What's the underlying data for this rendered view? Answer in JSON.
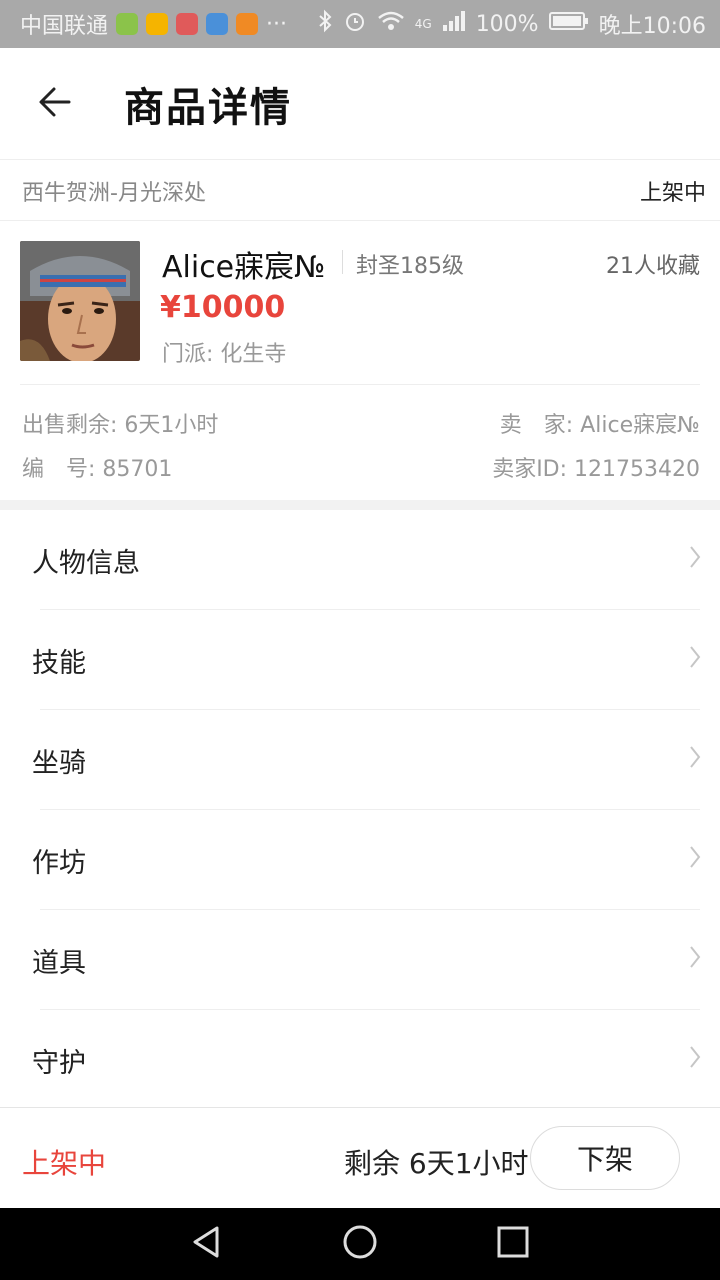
{
  "statusbar": {
    "carrier": "中国联通",
    "more": "···",
    "network": "4G",
    "battery": "100%",
    "time": "晚上10:06",
    "app_icons": [
      {
        "name": "green-app-icon",
        "color": "#8bc34a"
      },
      {
        "name": "weibo-icon",
        "color": "#f5b400"
      },
      {
        "name": "shop-app-icon",
        "color": "#e05a5a"
      },
      {
        "name": "boat-app-icon",
        "color": "#4a90d9"
      },
      {
        "name": "video-app-icon",
        "color": "#f08a24"
      }
    ]
  },
  "header": {
    "title": "商品详情"
  },
  "server": {
    "name": "西牛贺洲-月光深处",
    "status": "上架中"
  },
  "item": {
    "name": "Alice寐宸№",
    "level": "封圣185级",
    "favorites": "21人收藏",
    "price": "¥10000",
    "sect": "门派: 化生寺"
  },
  "meta": {
    "time_left": "出售剩余: 6天1小时",
    "seller": "卖　家: Alice寐宸№",
    "number": "编　号: 85701",
    "seller_id": "卖家ID: 121753420"
  },
  "menu": [
    {
      "label": "人物信息"
    },
    {
      "label": "技能"
    },
    {
      "label": "坐骑"
    },
    {
      "label": "作坊"
    },
    {
      "label": "道具"
    },
    {
      "label": "守护"
    }
  ],
  "bottom": {
    "status": "上架中",
    "remaining": "剩余 6天1小时",
    "delist_label": "下架"
  },
  "colors": {
    "accent_red": "#e8453c",
    "statusbar_bg": "#a9a9a9"
  }
}
